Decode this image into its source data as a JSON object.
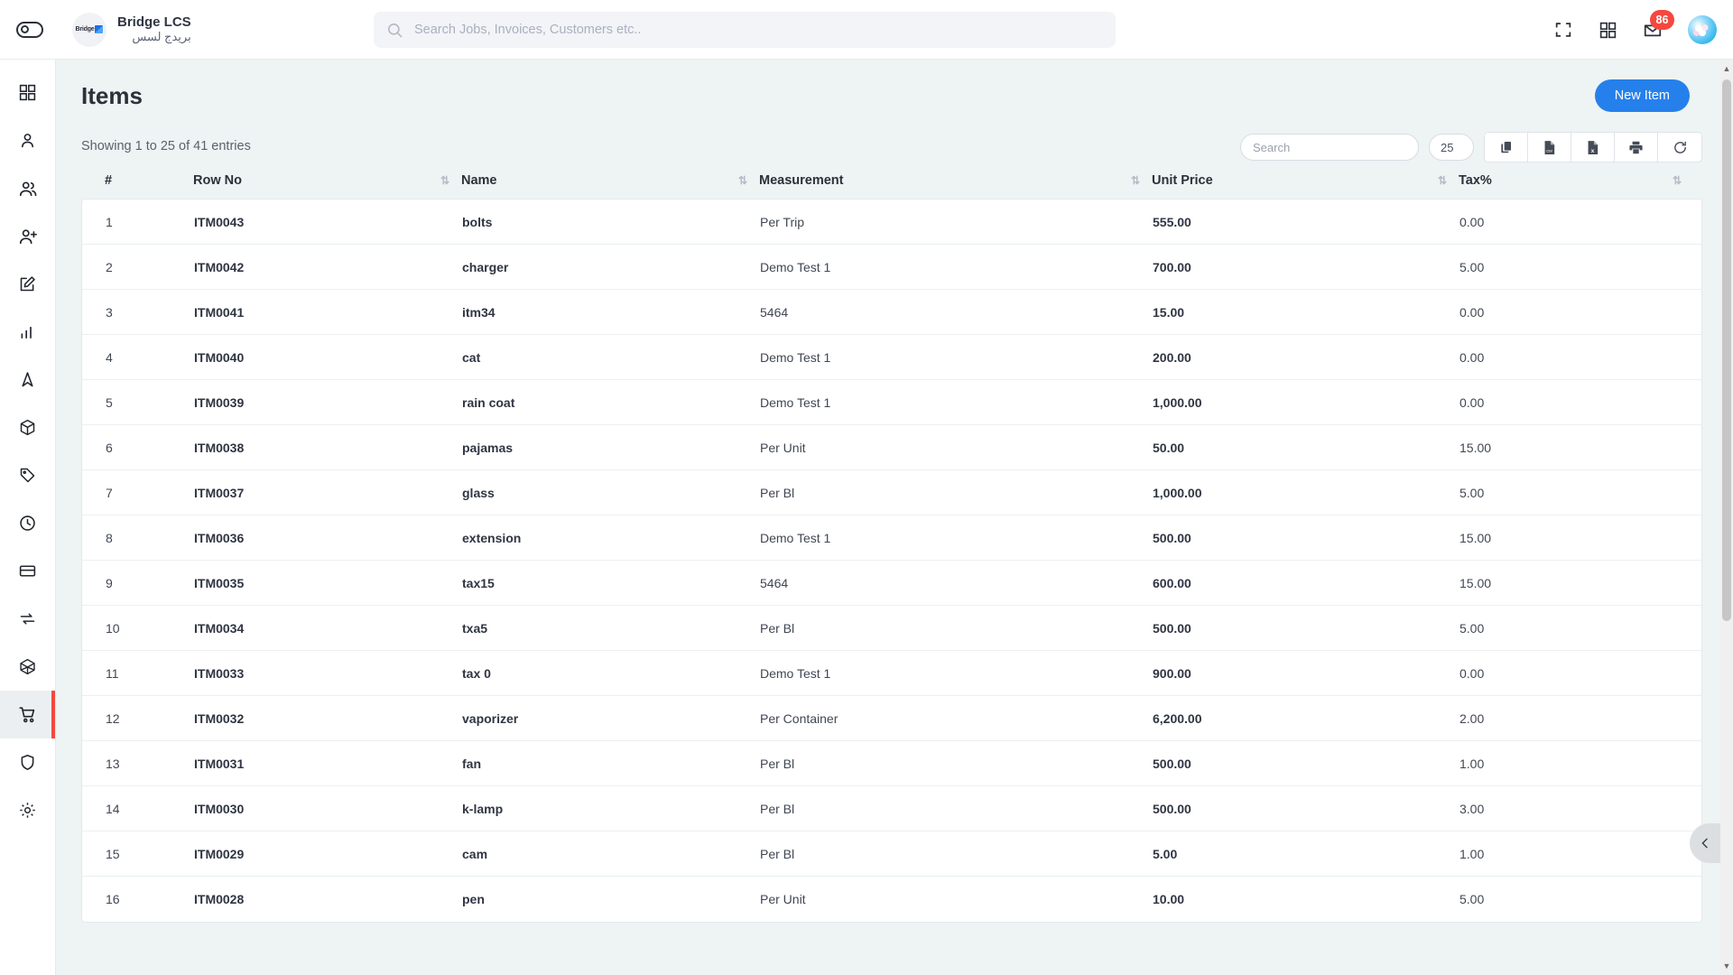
{
  "topbar": {
    "toggle_icon": "sidebar-toggle-icon",
    "brand_en": "Bridge LCS",
    "brand_ar": "بريدج لسس",
    "brand_logo_text": "Bridge",
    "search": {
      "placeholder": "Search Jobs, Invoices, Customers etc..",
      "value": "",
      "icon": "search-icon"
    },
    "fullscreen_icon": "fullscreen-icon",
    "apps_icon": "grid-apps-icon",
    "notifications_icon": "notification-envelope-icon",
    "notifications_count": "86",
    "avatar_icon": "user-avatar",
    "badge_color": "#f4483f"
  },
  "sidebar": {
    "items": [
      {
        "name": "dashboard",
        "icon": "grid-dashboard-icon",
        "active": false
      },
      {
        "name": "customer",
        "icon": "user-icon",
        "active": false
      },
      {
        "name": "employees",
        "icon": "users-icon",
        "active": false
      },
      {
        "name": "add-user",
        "icon": "user-plus-icon",
        "active": false
      },
      {
        "name": "quotation",
        "icon": "edit-square-icon",
        "active": false
      },
      {
        "name": "reports",
        "icon": "bar-chart-icon",
        "active": false
      },
      {
        "name": "navigation",
        "icon": "navigation-arrow-icon",
        "active": false
      },
      {
        "name": "packages",
        "icon": "box-icon",
        "active": false
      },
      {
        "name": "tags",
        "icon": "tag-icon",
        "active": false
      },
      {
        "name": "timesheet",
        "icon": "clock-icon",
        "active": false
      },
      {
        "name": "payments",
        "icon": "credit-card-icon",
        "active": false
      },
      {
        "name": "transfers",
        "icon": "repeat-icon",
        "active": false
      },
      {
        "name": "assets",
        "icon": "cube-icon",
        "active": false
      },
      {
        "name": "items",
        "icon": "shopping-cart-icon",
        "active": true
      },
      {
        "name": "security",
        "icon": "shield-icon",
        "active": false
      },
      {
        "name": "settings",
        "icon": "gear-icon",
        "active": false
      }
    ],
    "active_indicator_color": "#f4483f"
  },
  "page": {
    "title": "Items",
    "new_item_label": "New Item",
    "accent_color": "#2680eb"
  },
  "table_toolbar": {
    "entries_info": "Showing 1 to 25 of 41 entries",
    "search_placeholder": "Search",
    "search_value": "",
    "page_length_value": "25",
    "buttons": [
      {
        "name": "copy-button",
        "icon": "copy-icon"
      },
      {
        "name": "csv-button",
        "icon": "file-csv-icon"
      },
      {
        "name": "excel-button",
        "icon": "file-excel-icon"
      },
      {
        "name": "print-button",
        "icon": "printer-icon"
      },
      {
        "name": "refresh-button",
        "icon": "refresh-icon"
      }
    ]
  },
  "table": {
    "columns": [
      {
        "label": "#",
        "sortable": false
      },
      {
        "label": "Row No",
        "sortable": true
      },
      {
        "label": "Name",
        "sortable": true
      },
      {
        "label": "Measurement",
        "sortable": true
      },
      {
        "label": "Unit Price",
        "sortable": true
      },
      {
        "label": "Tax%",
        "sortable": true
      }
    ],
    "sort_icon": "sort-updown-icon",
    "rows": [
      {
        "idx": "1",
        "row_no": "ITM0043",
        "name": "bolts",
        "measurement": "Per Trip",
        "unit_price": "555.00",
        "tax": "0.00"
      },
      {
        "idx": "2",
        "row_no": "ITM0042",
        "name": "charger",
        "measurement": "Demo Test 1",
        "unit_price": "700.00",
        "tax": "5.00"
      },
      {
        "idx": "3",
        "row_no": "ITM0041",
        "name": "itm34",
        "measurement": "5464",
        "unit_price": "15.00",
        "tax": "0.00"
      },
      {
        "idx": "4",
        "row_no": "ITM0040",
        "name": "cat",
        "measurement": "Demo Test 1",
        "unit_price": "200.00",
        "tax": "0.00"
      },
      {
        "idx": "5",
        "row_no": "ITM0039",
        "name": "rain coat",
        "measurement": "Demo Test 1",
        "unit_price": "1,000.00",
        "tax": "0.00"
      },
      {
        "idx": "6",
        "row_no": "ITM0038",
        "name": "pajamas",
        "measurement": "Per Unit",
        "unit_price": "50.00",
        "tax": "15.00"
      },
      {
        "idx": "7",
        "row_no": "ITM0037",
        "name": "glass",
        "measurement": "Per Bl",
        "unit_price": "1,000.00",
        "tax": "5.00"
      },
      {
        "idx": "8",
        "row_no": "ITM0036",
        "name": "extension",
        "measurement": "Demo Test 1",
        "unit_price": "500.00",
        "tax": "15.00"
      },
      {
        "idx": "9",
        "row_no": "ITM0035",
        "name": "tax15",
        "measurement": "5464",
        "unit_price": "600.00",
        "tax": "15.00"
      },
      {
        "idx": "10",
        "row_no": "ITM0034",
        "name": "txa5",
        "measurement": "Per Bl",
        "unit_price": "500.00",
        "tax": "5.00"
      },
      {
        "idx": "11",
        "row_no": "ITM0033",
        "name": "tax 0",
        "measurement": "Demo Test 1",
        "unit_price": "900.00",
        "tax": "0.00"
      },
      {
        "idx": "12",
        "row_no": "ITM0032",
        "name": "vaporizer",
        "measurement": "Per Container",
        "unit_price": "6,200.00",
        "tax": "2.00"
      },
      {
        "idx": "13",
        "row_no": "ITM0031",
        "name": "fan",
        "measurement": "Per Bl",
        "unit_price": "500.00",
        "tax": "1.00"
      },
      {
        "idx": "14",
        "row_no": "ITM0030",
        "name": "k-lamp",
        "measurement": "Per Bl",
        "unit_price": "500.00",
        "tax": "3.00"
      },
      {
        "idx": "15",
        "row_no": "ITM0029",
        "name": "cam",
        "measurement": "Per Bl",
        "unit_price": "5.00",
        "tax": "1.00"
      },
      {
        "idx": "16",
        "row_no": "ITM0028",
        "name": "pen",
        "measurement": "Per Unit",
        "unit_price": "10.00",
        "tax": "5.00"
      }
    ]
  },
  "right_panel": {
    "collapse_icon": "chevron-left-icon"
  },
  "scrollbar": {
    "up_icon": "scroll-up-arrow-icon",
    "down_icon": "scroll-down-arrow-icon"
  }
}
